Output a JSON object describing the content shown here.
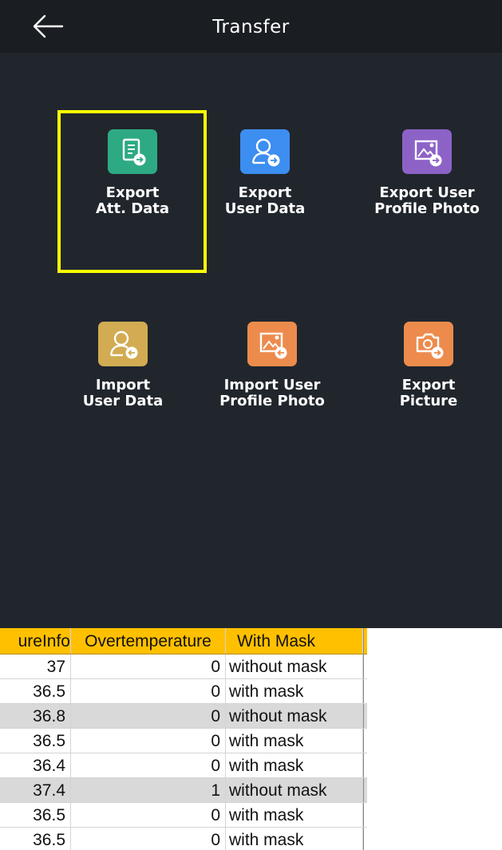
{
  "header": {
    "title": "Transfer",
    "back_icon": "arrow-left-icon"
  },
  "tiles": [
    {
      "line1": "Export",
      "line2": "Att. Data",
      "icon": "export-document-icon",
      "color": "#2daa83",
      "selected": true
    },
    {
      "line1": "Export",
      "line2": "User Data",
      "icon": "export-user-icon",
      "color": "#3c8ef0"
    },
    {
      "line1": "Export User",
      "line2": "Profile Photo",
      "icon": "export-photo-icon",
      "color": "#8d62c7"
    },
    {
      "line1": "Import",
      "line2": "User Data",
      "icon": "import-user-icon",
      "color": "#d2ab52"
    },
    {
      "line1": "Import User",
      "line2": "Profile Photo",
      "icon": "import-photo-icon",
      "color": "#ed8b4d"
    },
    {
      "line1": "Export",
      "line2": "Picture",
      "icon": "export-camera-icon",
      "color": "#ed8b4d"
    }
  ],
  "highlight_color": "#ffff00",
  "sheet": {
    "header_color": "#ffc000",
    "headers": [
      "ureInfo",
      "Overtemperature",
      "With Mask"
    ],
    "rows": [
      [
        "37",
        "0",
        "without mask"
      ],
      [
        "36.5",
        "0",
        "with mask"
      ],
      [
        "36.8",
        "0",
        "without mask"
      ],
      [
        "36.5",
        "0",
        "with mask"
      ],
      [
        "36.4",
        "0",
        "with mask"
      ],
      [
        "37.4",
        "1",
        "without mask"
      ],
      [
        "36.5",
        "0",
        "with mask"
      ],
      [
        "36.5",
        "0",
        "with mask"
      ]
    ]
  }
}
